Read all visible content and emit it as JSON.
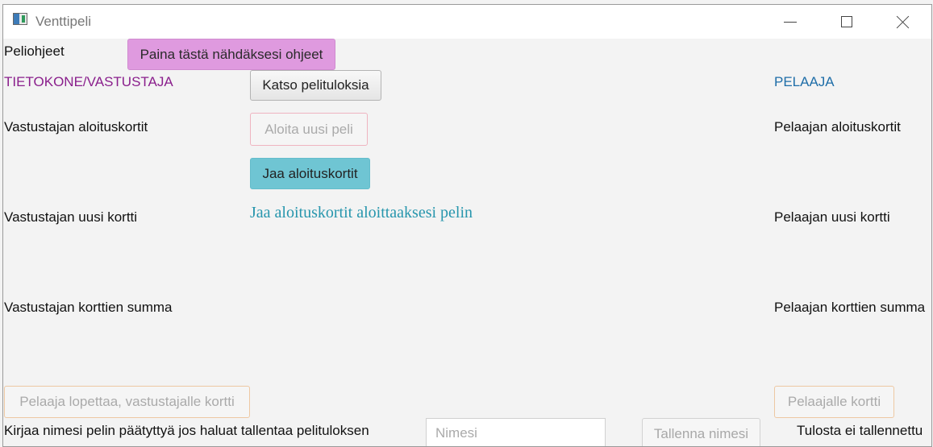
{
  "window": {
    "title": "Venttipeli"
  },
  "instructions": {
    "label": "Peliohjeet",
    "help_button": "Paina tästä nähdäksesi ohjeet"
  },
  "opponent": {
    "heading": "TIETOKONE/VASTUSTAJA",
    "starting_cards_label": "Vastustajan aloituskortit",
    "new_card_label": "Vastustajan uusi kortti",
    "sum_label": "Vastustajan korttien summa"
  },
  "player": {
    "heading": "PELAAJA",
    "starting_cards_label": "Pelaajan aloituskortit",
    "new_card_label": "Pelaajan uusi kortti",
    "sum_label": "Pelaajan korttien summa"
  },
  "controls": {
    "results_button": "Katso pelituloksia",
    "new_game_button": "Aloita uusi peli",
    "deal_button": "Jaa aloituskortit",
    "status": "Jaa aloituskortit aloittaaksesi pelin",
    "player_stops_button": "Pelaaja lopettaa, vastustajalle kortti",
    "player_card_button": "Pelaajalle kortti"
  },
  "save": {
    "prompt": "Kirjaa nimesi pelin päätyttyä jos haluat tallentaa pelituloksen",
    "name_placeholder": "Nimesi",
    "save_button": "Tallenna nimesi",
    "save_status": "Tulosta ei tallennettu"
  },
  "colors": {
    "opponent_heading": "#8a1f8c",
    "player_heading": "#1f6ea8",
    "help_button": "#df9adf",
    "deal_button": "#6fc5d3",
    "status_text": "#2796ad"
  }
}
